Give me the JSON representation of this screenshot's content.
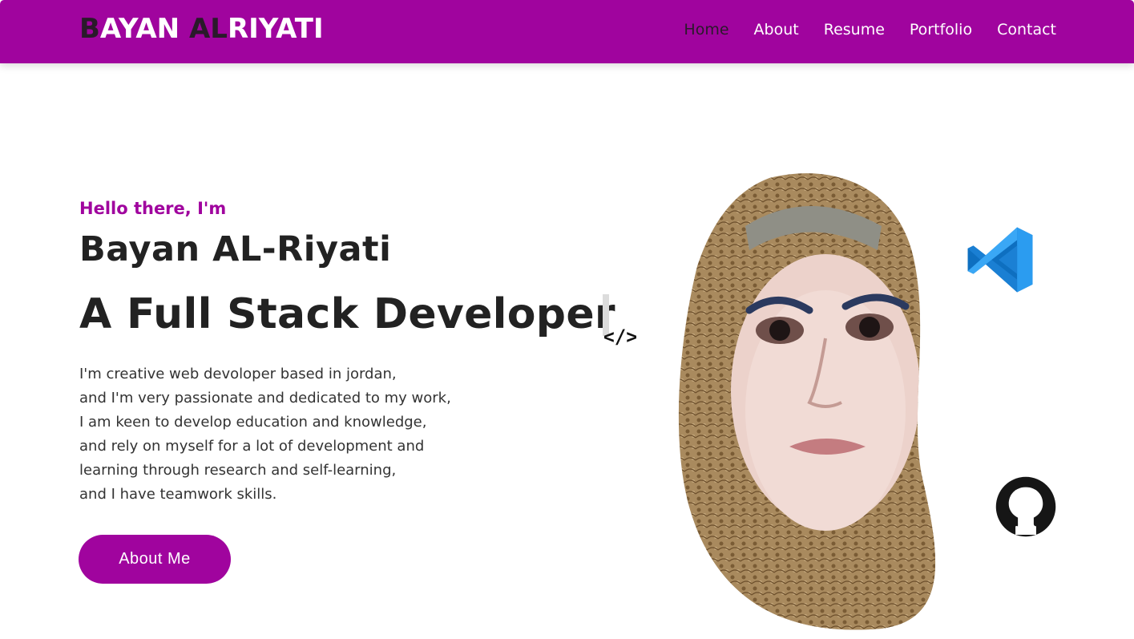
{
  "header": {
    "brand_part1": "B",
    "brand_part2": "AYAN ",
    "brand_part3": "AL",
    "brand_part4": "RIYATI",
    "nav": [
      {
        "label": "Home",
        "active": true
      },
      {
        "label": "About",
        "active": false
      },
      {
        "label": "Resume",
        "active": false
      },
      {
        "label": "Portfolio",
        "active": false
      },
      {
        "label": "Contact",
        "active": false
      }
    ]
  },
  "hero": {
    "greeting": "Hello there, I'm",
    "name": "Bayan AL-Riyati",
    "role": "A Full Stack Developer",
    "bio": [
      "I'm creative web devoloper based in jordan,",
      "and I'm very passionate and dedicated to my work,",
      "I am keen to develop education and knowledge,",
      "and rely on myself for a lot of development and",
      "learning through research and self-learning,",
      "and I have teamwork skills."
    ],
    "cta_label": "About Me",
    "code_symbol": "</>"
  },
  "icons": {
    "editor": "vscode-icon",
    "repo": "github-icon",
    "code": "code-icon"
  },
  "colors": {
    "accent": "#a0049e",
    "dark_text": "#222222",
    "nav_active": "#2a1a2a",
    "white": "#ffffff"
  }
}
